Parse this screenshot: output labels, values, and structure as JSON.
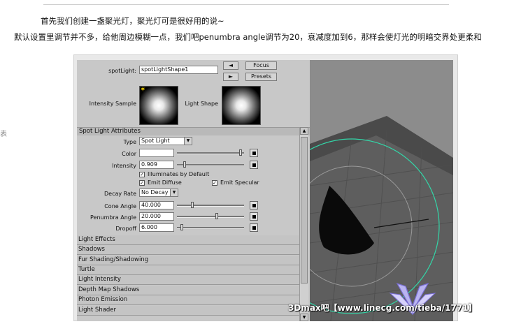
{
  "article": {
    "line1": "首先我们创建一盏聚光灯，聚光灯可是很好用的说~",
    "line2": "默认设置里调节并不多，给他周边模糊一点，我们吧penumbra angle调节为20，衰减度加到6，那样会使灯光的明暗交界处更柔和",
    "edge_char": "表"
  },
  "editor": {
    "spotlight_label": "spotLight:",
    "spotlight_value": "spotLightShape1",
    "focus_label": "Focus",
    "presets_label": "Presets",
    "intensity_sample_label": "Intensity Sample",
    "light_shape_label": "Light Shape",
    "section_title": "Spot Light Attributes",
    "type_label": "Type",
    "type_value": "Spot Light",
    "color_label": "Color",
    "intensity_label": "Intensity",
    "intensity_value": "0.909",
    "illum_default_label": "Illuminates by Default",
    "emit_diffuse_label": "Emit Diffuse",
    "emit_specular_label": "Emit Specular",
    "decay_label": "Decay Rate",
    "decay_value": "No Decay",
    "cone_label": "Cone Angle",
    "cone_value": "40.000",
    "penumbra_label": "Penumbra Angle",
    "penumbra_value": "20.000",
    "dropoff_label": "Dropoff",
    "dropoff_value": "6.000",
    "collapsed_sections": [
      "Light Effects",
      "Shadows",
      "Fur Shading/Shadowing",
      "Turtle",
      "Light Intensity",
      "Depth Map Shadows",
      "Photon Emission",
      "Light Shader"
    ],
    "sliders": {
      "color": 0.97,
      "intensity": 0.1,
      "cone": 0.22,
      "penumbra": 0.6,
      "dropoff": 0.05
    }
  },
  "watermark": "3Dmax吧【www.linecg.com/tieba/1771】",
  "colors": {
    "panel": "#c8c8c8",
    "viewport": "#8a8a8a",
    "ring": "#33d6a8"
  }
}
